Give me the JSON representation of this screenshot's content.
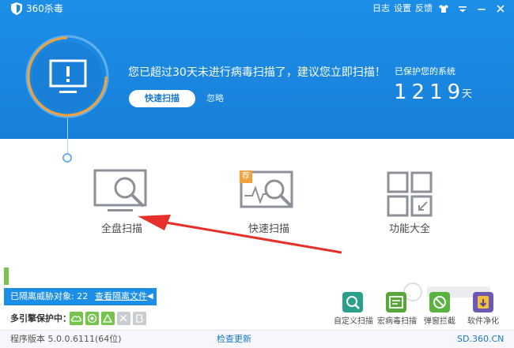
{
  "window": {
    "title": "360杀毒",
    "links": {
      "log": "日志",
      "settings": "设置",
      "feedback": "反馈"
    }
  },
  "hero": {
    "message": "您已超过30天未进行病毒扫描了，建议您立即扫描！",
    "scan_button": "快速扫描",
    "ignore": "忽略",
    "protect_label": "已保护您的系统",
    "protect_days": "1219",
    "protect_unit": "天"
  },
  "tools": {
    "full_scan": "全盘扫描",
    "quick_scan": "快速扫描",
    "quick_badge": "荐",
    "functions": "功能大全"
  },
  "quarantine": {
    "label": "已隔离威胁对象: 22",
    "view_link": "查看隔离文件"
  },
  "engines": {
    "label": "多引擎保护中："
  },
  "mini_tools": [
    {
      "label": "自定义扫描"
    },
    {
      "label": "宏病毒扫描"
    },
    {
      "label": "弹窗拦截"
    },
    {
      "label": "软件净化"
    }
  ],
  "status": {
    "version": "程序版本 5.0.0.6111(64位)",
    "check_update": "检查更新",
    "site": "SD.360.CN"
  },
  "colors": {
    "brand_blue": "#1d8ee6",
    "ring_orange": "#f3a13a",
    "arrow_red": "#e8302a",
    "engine_green": "#76c44c"
  }
}
